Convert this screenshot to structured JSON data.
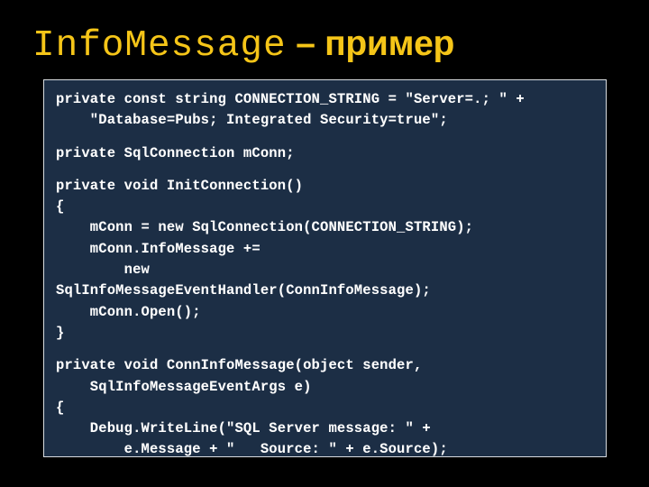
{
  "slide": {
    "background_color": "#000000",
    "title": {
      "mono_part": "InfoMessage",
      "sans_part": " – пример",
      "color": "#F5C518"
    },
    "code_box": {
      "background_color": "#1C2E45",
      "border_color": "#D8DCE0",
      "text_color": "#FFFFFF",
      "language": "csharp",
      "lines": [
        "private const string CONNECTION_STRING = \"Server=.; \" +",
        "    \"Database=Pubs; Integrated Security=true\";",
        "",
        "private SqlConnection mConn;",
        "",
        "private void InitConnection()",
        "{",
        "    mConn = new SqlConnection(CONNECTION_STRING);",
        "    mConn.InfoMessage +=",
        "        new",
        "SqlInfoMessageEventHandler(ConnInfoMessage);",
        "    mConn.Open();",
        "}",
        "",
        "private void ConnInfoMessage(object sender,",
        "    SqlInfoMessageEventArgs e)",
        "{",
        "    Debug.WriteLine(\"SQL Server message: \" +",
        "        e.Message + \"   Source: \" + e.Source);",
        "}"
      ]
    }
  }
}
